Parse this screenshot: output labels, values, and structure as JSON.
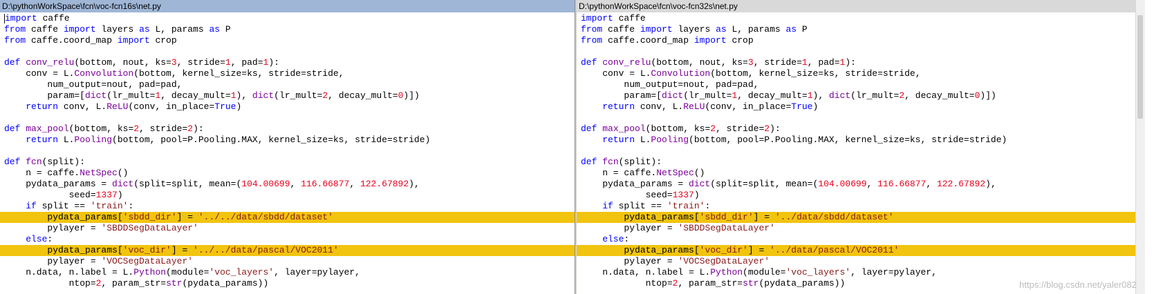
{
  "left_pane": {
    "title": "D:\\pythonWorkSpace\\fcn\\voc-fcn16s\\net.py",
    "sbdd_dir": "'../../data/sbdd/dataset'",
    "voc_dir": "'../../data/pascal/VOC2011'"
  },
  "right_pane": {
    "title": "D:\\pythonWorkSpace\\fcn\\voc-fcn32s\\net.py",
    "sbdd_dir": "'../data/sbdd/dataset'",
    "voc_dir": "'../data/pascal/VOC2011'"
  },
  "code": {
    "l1_kw": "import",
    "l1_rest": " caffe",
    "l2_kw1": "from",
    "l2_mid": " caffe ",
    "l2_kw2": "import",
    "l2_mid2": " layers ",
    "l2_kw3": "as",
    "l2_mid3": " L, params ",
    "l2_kw4": "as",
    "l2_end": " P",
    "l3_kw1": "from",
    "l3_mid": " caffe.coord_map ",
    "l3_kw2": "import",
    "l3_end": " crop",
    "l5_kw": "def",
    "l5_fn": "conv_relu",
    "l5_a": "(bottom, nout, ks=",
    "l5_n1": "3",
    "l5_b": ", stride=",
    "l5_n2": "1",
    "l5_c": ", pad=",
    "l5_n3": "1",
    "l5_d": "):",
    "l6_a": "    conv = L.",
    "l6_fn": "Convolution",
    "l6_b": "(bottom, kernel_size=ks, stride=stride,",
    "l7": "        num_output=nout, pad=pad,",
    "l8_a": "        param=[",
    "l8_fn1": "dict",
    "l8_b": "(lr_mult=",
    "l8_n1": "1",
    "l8_c": ", decay_mult=",
    "l8_n2": "1",
    "l8_d": "), ",
    "l8_fn2": "dict",
    "l8_e": "(lr_mult=",
    "l8_n3": "2",
    "l8_f": ", decay_mult=",
    "l8_n4": "0",
    "l8_g": ")])",
    "l9_kw": "    return",
    "l9_a": " conv, L.",
    "l9_fn": "ReLU",
    "l9_b": "(conv, in_place=",
    "l9_kw2": "True",
    "l9_c": ")",
    "l11_kw": "def",
    "l11_fn": "max_pool",
    "l11_a": "(bottom, ks=",
    "l11_n1": "2",
    "l11_b": ", stride=",
    "l11_n2": "2",
    "l11_c": "):",
    "l12_kw": "    return",
    "l12_a": " L.",
    "l12_fn": "Pooling",
    "l12_b": "(bottom, pool=P.Pooling.MAX, kernel_size=ks, stride=stride)",
    "l14_kw": "def",
    "l14_fn": "fcn",
    "l14_a": "(split):",
    "l15_a": "    n = caffe.",
    "l15_fn": "NetSpec",
    "l15_b": "()",
    "l16_a": "    pydata_params = ",
    "l16_fn": "dict",
    "l16_b": "(split=split, mean=(",
    "l16_n1": "104.00699",
    "l16_c": ", ",
    "l16_n2": "116.66877",
    "l16_d": ", ",
    "l16_n3": "122.67892",
    "l16_e": "),",
    "l17_a": "            seed=",
    "l17_n": "1337",
    "l17_b": ")",
    "l18_kw": "    if",
    "l18_a": " split == ",
    "l18_s": "'train'",
    "l18_b": ":",
    "l19_a": "        pydata_params[",
    "l19_s": "'sbdd_dir'",
    "l19_b": "] = ",
    "l20_a": "        pylayer = ",
    "l20_s": "'SBDDSegDataLayer'",
    "l21_kw": "    else",
    "l21_a": ":",
    "l22_a": "        pydata_params[",
    "l22_s": "'voc_dir'",
    "l22_b": "] = ",
    "l23_a": "        pylayer = ",
    "l23_s": "'VOCSegDataLayer'",
    "l24_a": "    n.data, n.label = L.",
    "l24_fn": "Python",
    "l24_b": "(module=",
    "l24_s": "'voc_layers'",
    "l24_c": ", layer=pylayer,",
    "l25_a": "            ntop=",
    "l25_n": "2",
    "l25_b": ", param_str=",
    "l25_fn": "str",
    "l25_c": "(pydata_params))"
  },
  "watermark": "https://blog.csdn.net/yaler082",
  "colors": {
    "keyword": "#0000ff",
    "function": "#7b0099",
    "number": "#e6001c",
    "string": "#8b1a1a",
    "highlight": "#f1c40f",
    "left_title_bg": "#9fb6d6",
    "right_title_bg": "#d9d9d9"
  }
}
